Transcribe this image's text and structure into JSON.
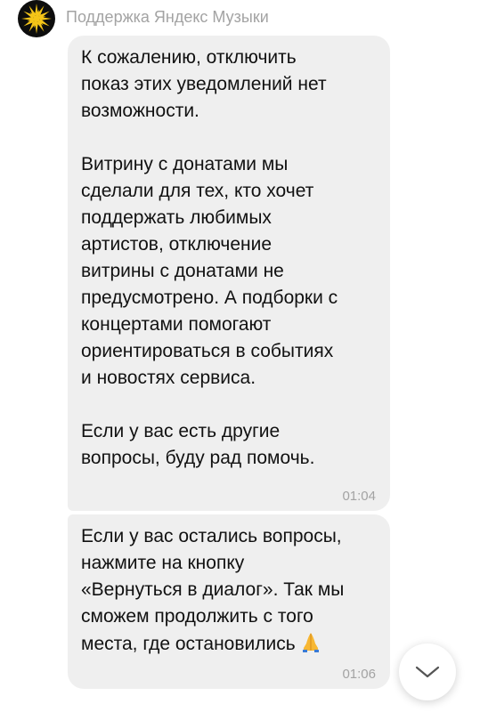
{
  "chat": {
    "sender_name": "Поддержка Яндекс Музыки",
    "avatar_icon": "yandex-music-sun-icon",
    "messages": [
      {
        "text": "К сожалению, отключить\nпоказ этих уведомлений нет\nвозможности.\n\nВитрину с донатами мы\nсделали для тех, кто хочет\nподдержать любимых\nартистов, отключение\nвитрины с донатами не\nпредусмотрено. А подборки с\nконцертами помогают\nориентироваться в событиях\nи новостях сервиса.\n\nЕсли у вас есть другие\nвопросы, буду рад помочь.",
        "time": "01:04"
      },
      {
        "text": "Если у вас остались вопросы,\nнажмите на кнопку\n«Вернуться в диалог». Так мы\nсможем продолжить с того\nместа, где остановились",
        "emoji_icon": "folded-hands-icon",
        "time": "01:06"
      }
    ],
    "scroll_button_icon": "chevron-down-icon"
  },
  "colors": {
    "bubble": "#efefef",
    "secondary_text": "#a3a3a3",
    "avatar_bg": "#0d0d0d",
    "avatar_accent": "#f5c518"
  }
}
